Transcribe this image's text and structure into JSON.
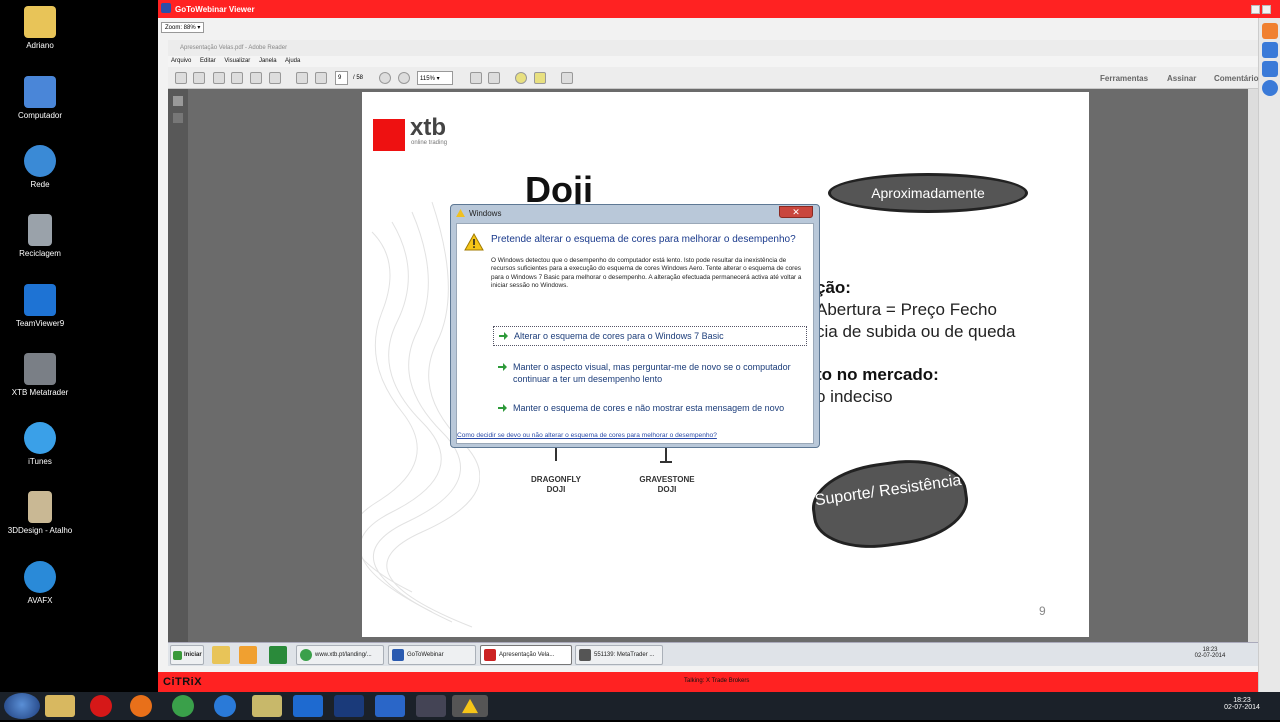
{
  "desktop": {
    "icons": [
      {
        "label": "Adriano",
        "icon": "folder-icon",
        "color": "#e8c458"
      },
      {
        "label": "Computador",
        "icon": "computer-icon",
        "color": "#4a86d8"
      },
      {
        "label": "Rede",
        "icon": "network-icon",
        "color": "#3a8ad6"
      },
      {
        "label": "Reciclagem",
        "icon": "recycle-bin-icon",
        "color": "#9aa2aa"
      },
      {
        "label": "TeamViewer9",
        "icon": "teamviewer-icon",
        "color": "#1e73d4"
      },
      {
        "label": "XTB Metatrader",
        "icon": "metatrader-icon",
        "color": "#7a7f86"
      },
      {
        "label": "iTunes",
        "icon": "itunes-icon",
        "color": "#3aa0e8"
      },
      {
        "label": "3DDesign - Atalho",
        "icon": "document-icon",
        "color": "#c9b894"
      },
      {
        "label": "AVAFX",
        "icon": "avafx-icon",
        "color": "#2a8ad8"
      }
    ]
  },
  "gotowebinar": {
    "title": "GoToWebinar Viewer",
    "zoom": "Zoom: 88%"
  },
  "adobe": {
    "title": "Apresentação Velas.pdf - Adobe Reader",
    "menu": [
      "Arquivo",
      "Editar",
      "Visualizar",
      "Janela",
      "Ajuda"
    ],
    "page_current": "9",
    "page_total": "/ 58",
    "zoom": "115%",
    "links": [
      "Ferramentas",
      "Assinar",
      "Comentário"
    ]
  },
  "slide": {
    "brand": "xtb",
    "brand_sub": "online trading",
    "title": "Doji",
    "cloud_top": "Aproximadamente",
    "cloud_bottom": "Suporte/ Resistência",
    "line1": "ção:",
    "line2": "Abertura = Preço Fecho",
    "line3": "cia de subida ou de queda",
    "line4": "to no mercado:",
    "line5": "o indeciso",
    "cap1": "DRAGONFLY DOJI",
    "cap2": "GRAVESTONE DOJI",
    "page": "9"
  },
  "dialog": {
    "title": "Windows",
    "heading": "Pretende alterar o esquema de cores para melhorar o desempenho?",
    "description": "O Windows detectou que o desempenho do computador está lento. Isto pode resultar da inexistência de recursos suficientes para a execução do esquema de cores Windows Aero. Tente alterar o esquema de cores para o Windows 7 Basic para melhorar o desempenho. A alteração efectuada permanecerá activa até voltar a iniciar sessão no Windows.",
    "option1": "Alterar o esquema de cores para o Windows 7 Basic",
    "option2": "Manter o aspecto visual, mas perguntar-me de novo se o computador continuar a ter um desempenho lento",
    "option3": "Manter o esquema de cores e não mostrar esta mensagem de novo",
    "link": "Como decidir se devo ou não alterar o esquema de cores para melhorar o desempenho?"
  },
  "remote_taskbar": {
    "start": "Iniciar",
    "items": [
      "www.xtb.pt/landing/...",
      "GoToWebinar",
      "Apresentação Vela...",
      "551139: MetaTrader ..."
    ],
    "time": "18:23",
    "date": "02-07-2014"
  },
  "citrix": {
    "logo": "CiTRiX",
    "talking": "Talking: X Trade Brokers"
  },
  "host_taskbar": {
    "time": "18:23",
    "date": "02-07-2014"
  },
  "colors": {
    "gtw_red": "#ff2222",
    "xtb_red": "#e11",
    "dialog_blue": "#1a3a8c"
  }
}
